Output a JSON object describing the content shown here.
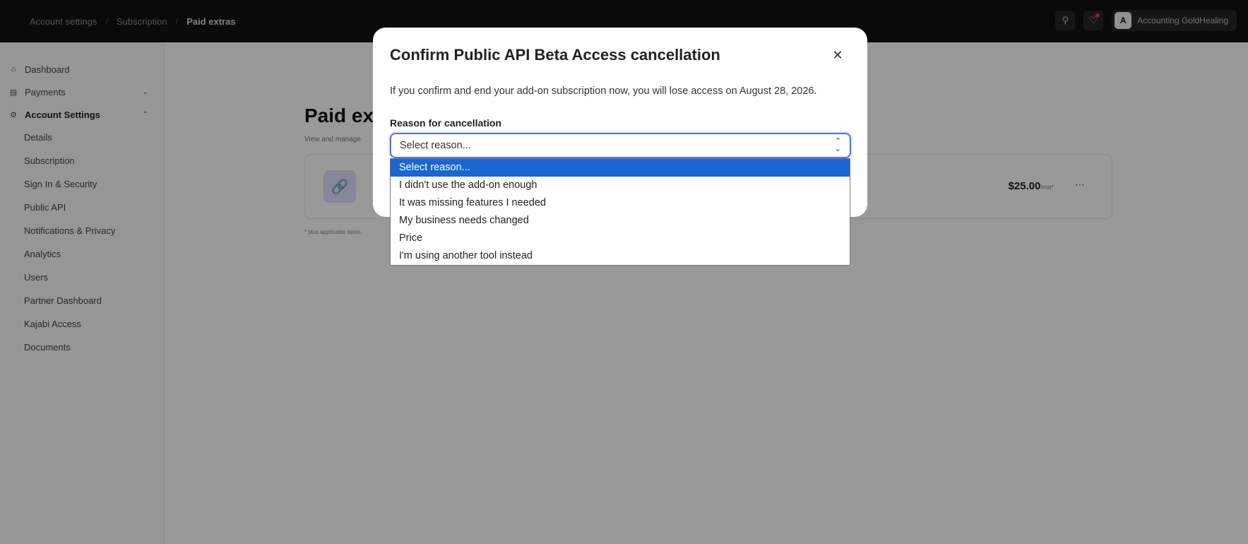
{
  "topbar": {
    "breadcrumb": [
      "Account settings",
      "Subscription",
      "Paid extras"
    ],
    "separator": "/",
    "pin_icon": "pin-icon",
    "bell_icon": "bell-icon",
    "account_name": "Accounting GoldHealing",
    "account_initial": "A"
  },
  "sidebar": {
    "items": [
      {
        "label": "Dashboard",
        "icon": "home-icon"
      },
      {
        "label": "Payments",
        "icon": "card-icon"
      },
      {
        "label": "Account Settings",
        "icon": "gear-icon"
      }
    ],
    "subitems": [
      "Details",
      "Subscription",
      "Sign In & Security",
      "Public API",
      "Notifications & Privacy",
      "Analytics",
      "Users",
      "Partner Dashboard",
      "Kajabi Access",
      "Documents"
    ]
  },
  "background": {
    "title": "Paid ext",
    "subtitle": "View and manage",
    "price": "$25.00",
    "price_unit": "/mo*",
    "footnote": "* plus applicable taxes"
  },
  "modal": {
    "title": "Confirm Public API Beta Access cancellation",
    "description": "If you confirm and end your add-on subscription now, you will lose access on August 28, 2026.",
    "field_label": "Reason for cancellation",
    "select_value": "Select reason...",
    "options": [
      "Select reason...",
      "I didn't use the add-on enough",
      "It was missing features I needed",
      "My business needs changed",
      "Price",
      "I'm using another tool instead"
    ]
  },
  "colors": {
    "accent": "#5b6ee1",
    "selected_option": "#1a66d2",
    "topbar": "#121212"
  }
}
